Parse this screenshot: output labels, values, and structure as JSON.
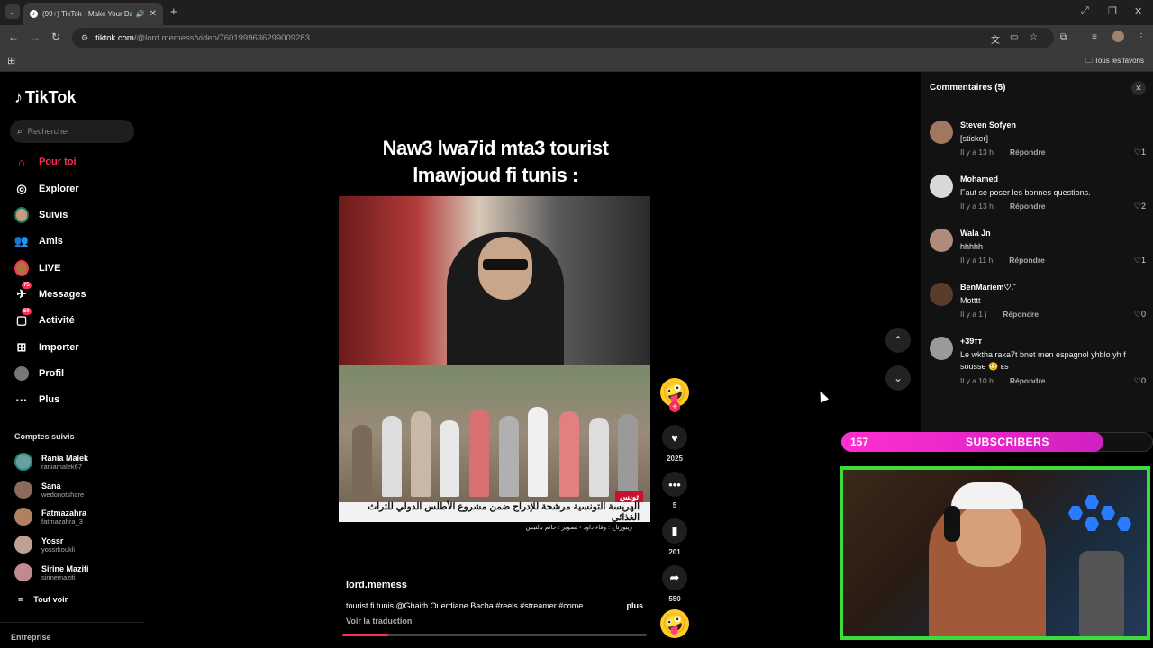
{
  "browser": {
    "tab_title": "(99+) TikTok - Make Your Day",
    "url_host": "tiktok.com",
    "url_path": "/@lord.memess/video/7601999636299009283",
    "bookmarks_label": "Tous les favoris"
  },
  "sidebar": {
    "logo": "TikTok",
    "search_placeholder": "Rechercher",
    "nav": [
      {
        "label": "Pour toi",
        "icon": "home-icon"
      },
      {
        "label": "Explorer",
        "icon": "compass-icon"
      },
      {
        "label": "Suivis",
        "icon": "following-avatar-icon"
      },
      {
        "label": "Amis",
        "icon": "friends-icon"
      },
      {
        "label": "LIVE",
        "icon": "live-avatar-icon"
      },
      {
        "label": "Messages",
        "icon": "messages-icon",
        "badge": "75"
      },
      {
        "label": "Activité",
        "icon": "activity-icon",
        "badge": "59"
      },
      {
        "label": "Importer",
        "icon": "upload-icon"
      },
      {
        "label": "Profil",
        "icon": "profile-icon"
      },
      {
        "label": "Plus",
        "icon": "more-icon"
      }
    ],
    "followed_title": "Comptes suivis",
    "accounts": [
      {
        "name": "Rania Malek",
        "handle": "raniamalek67",
        "color": "#6aa0a0"
      },
      {
        "name": "Sana",
        "handle": "wedonotshare",
        "color": "#8a6a5a"
      },
      {
        "name": "Fatmazahra",
        "handle": "fatmazahra_3",
        "color": "#b08060"
      },
      {
        "name": "Yossr",
        "handle": "yossrkoukli",
        "color": "#c0a090"
      },
      {
        "name": "Sirine Maziti",
        "handle": "sirinemaziti",
        "color": "#c08a90"
      }
    ],
    "see_all": "Tout voir",
    "footer": "Entreprise"
  },
  "video": {
    "caption_line1": "Naw3 lwa7id mta3 tourist",
    "caption_line2": "lmawjoud fi tunis :",
    "news_tag": "تونس",
    "news_headline": "الهريسة التونسية مرشحة للإدراج ضمن مشروع الأطلس الدولي للتراث الغذائي",
    "news_credit": "ريبورتاج : وفاء داود  •  تصوير : حاتم بالتيس",
    "author": "lord.memess",
    "description": "tourist fi tunis @Ghaith Ouerdiane Bacha #reels #streamer #come...",
    "more": "plus",
    "translate": "Voir la traduction",
    "progress": 0.15
  },
  "actions": {
    "likes": "2025",
    "comments": "5",
    "saves": "201",
    "shares": "550"
  },
  "comments": {
    "title": "Commentaires",
    "count": "(5)",
    "reply_label": "Répondre",
    "items": [
      {
        "user": "Steven Sofyen",
        "text": "[sticker]",
        "time": "Il y a 13 h",
        "likes": "1",
        "color": "#a07860"
      },
      {
        "user": "Mohamed",
        "text": "Faut se poser les bonnes questions.",
        "time": "Il y a 13 h",
        "likes": "2",
        "color": "#d8d8d8"
      },
      {
        "user": "Wala Jn",
        "text": "hhhhh",
        "time": "Il y a 11 h",
        "likes": "1",
        "color": "#b08a7a"
      },
      {
        "user": "BenMariem♡.˚",
        "text": "Motttt",
        "time": "Il y a 1 j",
        "likes": "0",
        "color": "#5a3a2a"
      },
      {
        "user": "+39ᴛᴛ",
        "text": "Le wktha raka7t bnet men espagnol yhblo yh f sousse 😳 ᴇs",
        "time": "Il y a 10 h",
        "likes": "0",
        "color": "#9a9a9a"
      }
    ]
  },
  "stream": {
    "sub_count": "157",
    "sub_label": "SUBSCRIBERS",
    "sub_progress": 0.84
  }
}
